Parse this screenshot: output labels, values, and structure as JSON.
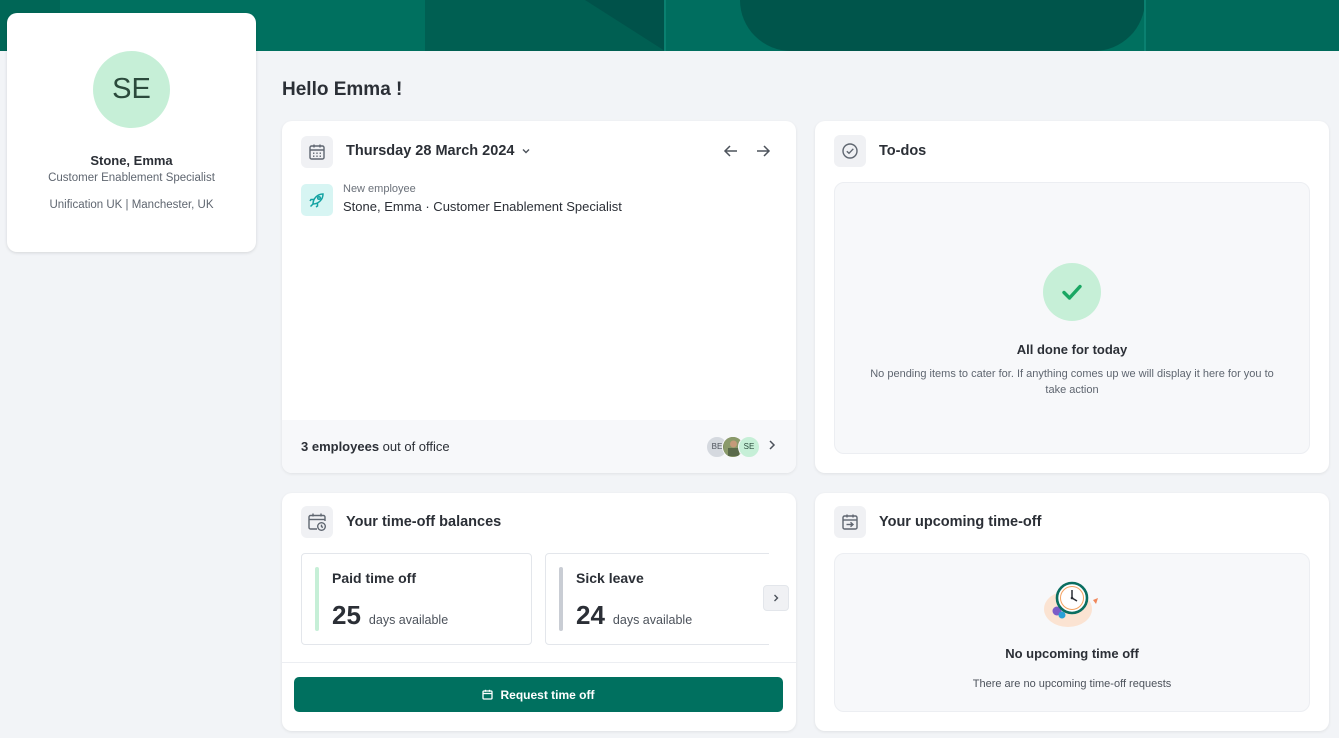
{
  "profile": {
    "initials": "SE",
    "name": "Stone, Emma",
    "role": "Customer Enablement Specialist",
    "location": "Unification UK | Manchester, UK"
  },
  "greeting": "Hello Emma !",
  "calendar": {
    "date_label": "Thursday 28 March 2024",
    "event": {
      "type": "New employee",
      "description": "Stone, Emma · Customer Enablement Specialist"
    },
    "out_of_office": {
      "count_label": "3 employees",
      "suffix": " out of office",
      "avatars": [
        "BE",
        "",
        "SE"
      ]
    }
  },
  "todos": {
    "title": "To-dos",
    "empty_title": "All done for today",
    "empty_desc": "No pending items to cater for. If anything comes up we will display it here for you to take action"
  },
  "balances": {
    "title": "Your time-off balances",
    "items": [
      {
        "name": "Paid time off",
        "value": "25",
        "unit": "days available",
        "color": "#c6efd7"
      },
      {
        "name": "Sick leave",
        "value": "24",
        "unit": "days available",
        "color": "#c9cdd4"
      }
    ],
    "request_label": "Request time off"
  },
  "upcoming": {
    "title": "Your upcoming time-off",
    "empty_title": "No upcoming time off",
    "empty_desc": "There are no upcoming time-off requests"
  },
  "colors": {
    "brand": "#00705f",
    "success": "#1aa763",
    "success_bg": "#c6efd7",
    "accent_teal": "#d7f5f3"
  }
}
